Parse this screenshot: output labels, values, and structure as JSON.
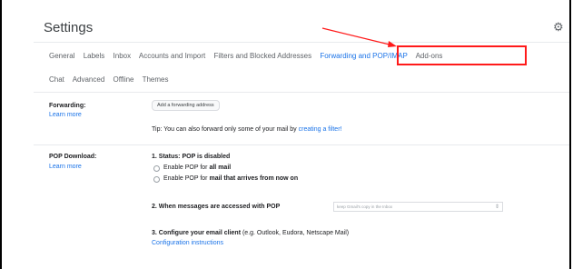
{
  "header": {
    "title": "Settings",
    "settings_icon": "gear-icon"
  },
  "tabs_row1": [
    {
      "label": "General"
    },
    {
      "label": "Labels"
    },
    {
      "label": "Inbox"
    },
    {
      "label": "Accounts and Import"
    },
    {
      "label": "Filters and Blocked Addresses"
    },
    {
      "label": "Forwarding and POP/IMAP",
      "active": true
    },
    {
      "label": "Add-ons"
    }
  ],
  "tabs_row2": [
    {
      "label": "Chat"
    },
    {
      "label": "Advanced"
    },
    {
      "label": "Offline"
    },
    {
      "label": "Themes"
    }
  ],
  "forwarding": {
    "label": "Forwarding:",
    "learn_more": "Learn more",
    "add_button": "Add a forwarding address",
    "tip_prefix": "Tip: You can also forward only some of your mail by ",
    "tip_link": "creating a filter!"
  },
  "pop": {
    "label": "POP Download:",
    "learn_more": "Learn more",
    "status": "1. Status: POP is disabled",
    "option1_prefix": "Enable POP for ",
    "option1_bold": "all mail",
    "option2_prefix": "Enable POP for ",
    "option2_bold": "mail that arrives from now on",
    "step2": "2. When messages are accessed with POP",
    "step2_select": "keep Gmail's copy in the Inbox",
    "step3_bold": "3. Configure your email client",
    "step3_rest": " (e.g. Outlook, Eudora, Netscape Mail)",
    "config_link": "Configuration instructions"
  },
  "colors": {
    "accent": "#1a73e8",
    "highlight": "#ff1a1a"
  }
}
